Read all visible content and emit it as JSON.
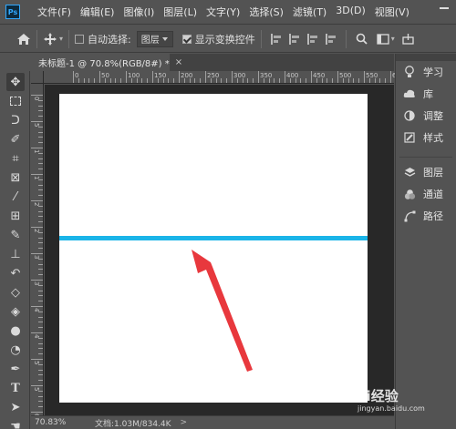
{
  "app": {
    "logo": "Ps"
  },
  "menu": [
    "文件(F)",
    "编辑(E)",
    "图像(I)",
    "图层(L)",
    "文字(Y)",
    "选择(S)",
    "滤镜(T)",
    "3D(D)",
    "视图(V)"
  ],
  "options": {
    "home_icon": "home-icon",
    "auto_select_label": "自动选择:",
    "auto_select_value": "图层",
    "show_transform_label": "显示变换控件",
    "show_transform_checked": true
  },
  "document_tab": {
    "title": "未标题-1 @ 70.8%(RGB/8#) *",
    "close": "×"
  },
  "ruler": {
    "h_labels": [
      "0",
      "50",
      "100",
      "150",
      "200",
      "250",
      "300",
      "350",
      "400",
      "450",
      "500",
      "550",
      "600"
    ],
    "v_labels": [
      "0",
      "5",
      "1",
      "1",
      "2",
      "2",
      "3",
      "3",
      "4",
      "4",
      "5",
      "5",
      "6"
    ]
  },
  "canvas": {
    "line_color": "#1ab4e8",
    "arrow_color": "#e8383d"
  },
  "status": {
    "zoom": "70.83%",
    "doc_info": "文档:1.03M/834.4K",
    "arrow": ">"
  },
  "panels": {
    "group1": [
      {
        "icon": "lightbulb-icon",
        "glyph": "💡",
        "label": "学习"
      },
      {
        "icon": "library-icon",
        "glyph": "☁",
        "label": "库"
      },
      {
        "icon": "adjustments-icon",
        "glyph": "◐",
        "label": "调整"
      },
      {
        "icon": "styles-icon",
        "glyph": "✎",
        "label": "样式"
      }
    ],
    "group2": [
      {
        "icon": "layers-icon",
        "glyph": "◆",
        "label": "图层"
      },
      {
        "icon": "channels-icon",
        "glyph": "◎",
        "label": "通道"
      },
      {
        "icon": "paths-icon",
        "glyph": "⌘",
        "label": "路径"
      }
    ]
  },
  "watermark": {
    "text": "Bai经验",
    "url": "jingyan.baidu.com"
  }
}
